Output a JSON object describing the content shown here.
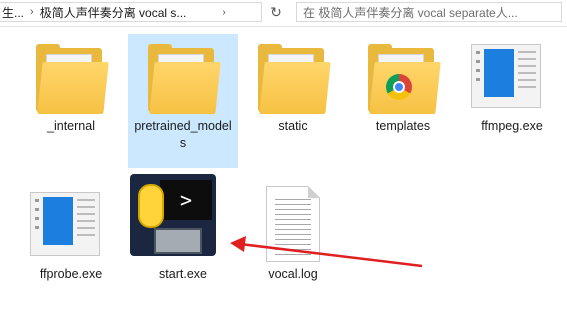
{
  "address_bar": {
    "breadcrumb_parent": "生...",
    "breadcrumb_current": "极简人声伴奏分离 vocal s...",
    "search_placeholder": "在 极简人声伴奏分离 vocal separate人..."
  },
  "files": [
    {
      "label": "_internal"
    },
    {
      "label": "pretrained_models"
    },
    {
      "label": "static"
    },
    {
      "label": "templates"
    },
    {
      "label": "ffmpeg.exe"
    },
    {
      "label": "ffprobe.exe"
    },
    {
      "label": "start.exe"
    },
    {
      "label": "vocal.log"
    }
  ],
  "colors": {
    "annotation_arrow": "#e02020",
    "selection": "#cce8ff"
  }
}
